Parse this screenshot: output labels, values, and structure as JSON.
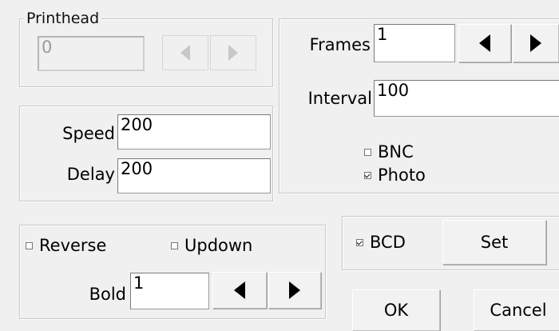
{
  "printhead": {
    "title": "Printhead",
    "value": "0"
  },
  "frames": {
    "label": "Frames",
    "value": "1"
  },
  "interval": {
    "label": "Interval",
    "value": "100"
  },
  "outputs": {
    "bnc": {
      "label": "BNC",
      "checked": false
    },
    "photo": {
      "label": "Photo",
      "checked": true
    }
  },
  "speed": {
    "label": "Speed",
    "value": "200"
  },
  "delay": {
    "label": "Delay",
    "value": "200"
  },
  "options": {
    "reverse": {
      "label": "Reverse",
      "checked": false
    },
    "updown": {
      "label": "Updown",
      "checked": false
    },
    "bold_label": "Bold",
    "bold_value": "1"
  },
  "bcd": {
    "label": "BCD",
    "checked": true,
    "set_label": "Set"
  },
  "actions": {
    "ok": "OK",
    "cancel": "Cancel"
  }
}
